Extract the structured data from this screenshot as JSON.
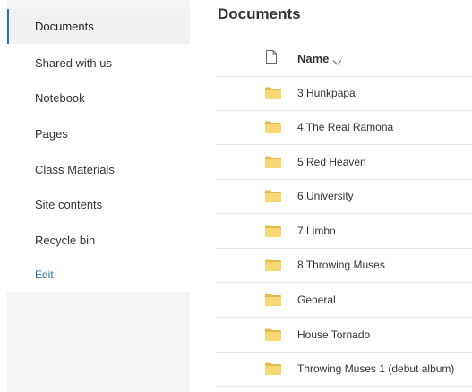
{
  "nav": {
    "items": [
      {
        "label": "Documents",
        "selected": true
      },
      {
        "label": "Shared with us"
      },
      {
        "label": "Notebook"
      },
      {
        "label": "Pages"
      },
      {
        "label": "Class Materials"
      },
      {
        "label": "Site contents"
      },
      {
        "label": "Recycle bin"
      }
    ],
    "edit_label": "Edit"
  },
  "main": {
    "title": "Documents",
    "columns": {
      "file_type_icon": "document-icon",
      "name_label": "Name",
      "sort_icon": "chevron-down-icon"
    },
    "rows": [
      {
        "name": "3 Hunkpapa",
        "icon": "folder-icon"
      },
      {
        "name": "4 The Real Ramona",
        "icon": "folder-icon"
      },
      {
        "name": "5 Red Heaven",
        "icon": "folder-icon"
      },
      {
        "name": "6 University",
        "icon": "folder-icon"
      },
      {
        "name": "7 Limbo",
        "icon": "folder-icon"
      },
      {
        "name": "8 Throwing Muses",
        "icon": "folder-icon"
      },
      {
        "name": "General",
        "icon": "folder-icon"
      },
      {
        "name": "House Tornado",
        "icon": "folder-icon"
      },
      {
        "name": "Throwing Muses 1 (debut album)",
        "icon": "folder-icon"
      }
    ]
  },
  "colors": {
    "accent": "#2c6fb7",
    "folder": "#f8d775",
    "folder_tab": "#e8b84a",
    "nav_background": "#f4f4f4",
    "divider": "#e8e8e8"
  }
}
